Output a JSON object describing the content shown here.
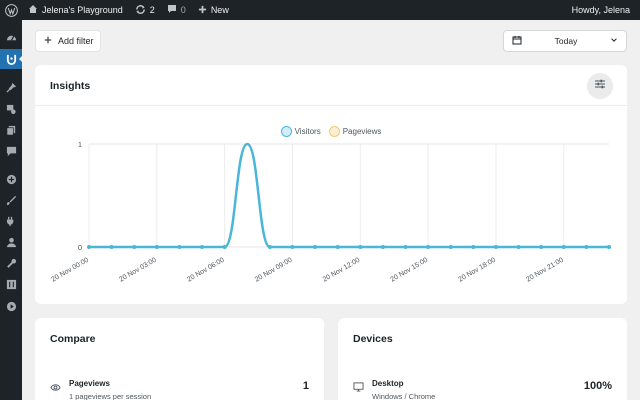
{
  "adminbar": {
    "site_name": "Jelena's Playground",
    "updates_count": "2",
    "comments_count": "0",
    "new_label": "New",
    "greeting": "Howdy, Jelena"
  },
  "sidebar": {
    "items": [
      {
        "icon": "dashboard-icon"
      },
      {
        "icon": "analytics-icon",
        "active": true
      },
      {
        "icon": "pin-icon"
      },
      {
        "icon": "media-icon"
      },
      {
        "icon": "pages-icon"
      },
      {
        "icon": "comments-icon"
      },
      {
        "icon": "plus-circle-icon"
      },
      {
        "icon": "brush-icon"
      },
      {
        "icon": "plugins-icon"
      },
      {
        "icon": "users-icon"
      },
      {
        "icon": "tools-icon"
      },
      {
        "icon": "settings-icon"
      },
      {
        "icon": "play-icon"
      }
    ]
  },
  "toolbar": {
    "add_filter_label": "Add filter",
    "date_range_label": "Today"
  },
  "insights": {
    "title": "Insights"
  },
  "chart_data": {
    "type": "line",
    "legend": [
      "Visitors",
      "Pageviews"
    ],
    "legend_position": "top-center",
    "x": [
      "20 Nov 00:00",
      "20 Nov 01:00",
      "20 Nov 02:00",
      "20 Nov 03:00",
      "20 Nov 04:00",
      "20 Nov 05:00",
      "20 Nov 06:00",
      "20 Nov 07:00",
      "20 Nov 08:00",
      "20 Nov 09:00",
      "20 Nov 10:00",
      "20 Nov 11:00",
      "20 Nov 12:00",
      "20 Nov 13:00",
      "20 Nov 14:00",
      "20 Nov 15:00",
      "20 Nov 16:00",
      "20 Nov 17:00",
      "20 Nov 18:00",
      "20 Nov 19:00",
      "20 Nov 20:00",
      "20 Nov 21:00",
      "20 Nov 22:00",
      "20 Nov 23:00"
    ],
    "tick_labels": [
      "20 Nov 00:00",
      "20 Nov 03:00",
      "20 Nov 06:00",
      "20 Nov 09:00",
      "20 Nov 12:00",
      "20 Nov 15:00",
      "20 Nov 18:00",
      "20 Nov 21:00"
    ],
    "series": [
      {
        "name": "Visitors",
        "values": [
          0,
          0,
          0,
          0,
          0,
          0,
          0,
          1,
          0,
          0,
          0,
          0,
          0,
          0,
          0,
          0,
          0,
          0,
          0,
          0,
          0,
          0,
          0,
          0
        ]
      },
      {
        "name": "Pageviews",
        "values": [
          0,
          0,
          0,
          0,
          0,
          0,
          0,
          1,
          0,
          0,
          0,
          0,
          0,
          0,
          0,
          0,
          0,
          0,
          0,
          0,
          0,
          0,
          0,
          0
        ]
      }
    ],
    "y_ticks": [
      "0",
      "1"
    ],
    "ylim": [
      0,
      1
    ],
    "grid": true,
    "colors": {
      "visitors": "#4ab6d9",
      "pageviews": "#f2c878"
    }
  },
  "compare": {
    "title": "Compare",
    "rows": [
      {
        "label": "Pageviews",
        "sub": "1 pageviews per session",
        "value": "1"
      }
    ]
  },
  "devices": {
    "title": "Devices",
    "rows": [
      {
        "label": "Desktop",
        "sub": "Windows / Chrome",
        "value": "100%"
      }
    ]
  }
}
